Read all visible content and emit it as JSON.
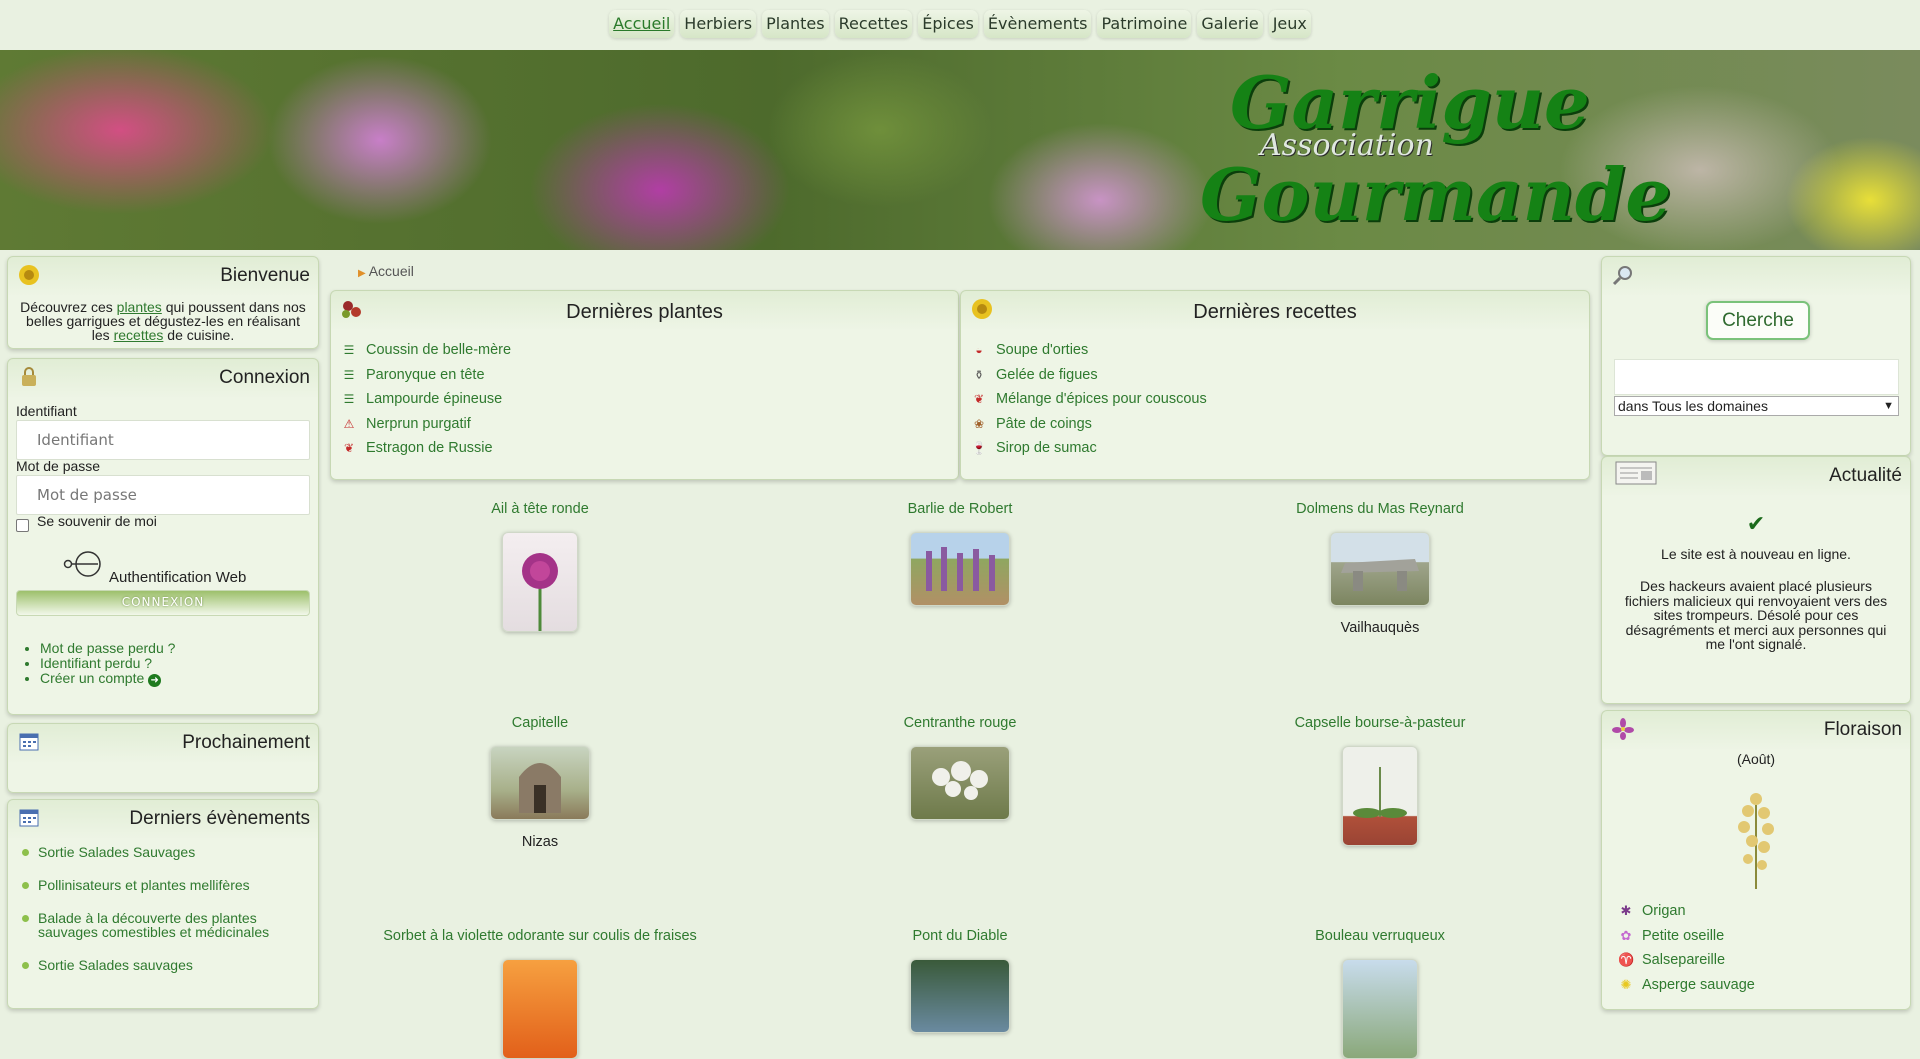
{
  "nav": [
    {
      "label": "Accueil",
      "active": true
    },
    {
      "label": "Herbiers"
    },
    {
      "label": "Plantes"
    },
    {
      "label": "Recettes"
    },
    {
      "label": "Épices"
    },
    {
      "label": "Évènements"
    },
    {
      "label": "Patrimoine"
    },
    {
      "label": "Galerie"
    },
    {
      "label": "Jeux"
    }
  ],
  "banner": {
    "line1": "Garrigue",
    "line2": "Association",
    "line3": "Gourmande"
  },
  "welcome": {
    "title": "Bienvenue",
    "t1": "Découvrez ces ",
    "link_plants": "plantes",
    "t2": " qui poussent dans nos belles garrigues et dégustez-les en réalisant les ",
    "link_recipes": "recettes",
    "t3": " de cuisine."
  },
  "login": {
    "title": "Connexion",
    "id_label": "Identifiant",
    "id_placeholder": "Identifiant",
    "pw_label": "Mot de passe",
    "pw_placeholder": "Mot de passe",
    "remember": "Se souvenir de moi",
    "web_auth": "Authentification Web",
    "button": "CONNEXION",
    "links": [
      "Mot de passe perdu ?",
      "Identifiant perdu ?",
      "Créer un compte"
    ]
  },
  "upcoming": {
    "title": "Prochainement"
  },
  "events": {
    "title": "Derniers évènements",
    "items": [
      "Sortie Salades Sauvages",
      "Pollinisateurs et plantes mellifères",
      "Balade à la découverte des plantes sauvages comestibles et médicinales",
      "Sortie Salades sauvages"
    ]
  },
  "breadcrumb": "Accueil",
  "latest_plants": {
    "title": "Dernières plantes",
    "items": [
      {
        "label": "Coussin de belle-mère",
        "icon": "list-icon"
      },
      {
        "label": "Paronyque en tête",
        "icon": "list-icon"
      },
      {
        "label": "Lampourde épineuse",
        "icon": "list-icon"
      },
      {
        "label": "Nerprun purgatif",
        "icon": "warning-icon"
      },
      {
        "label": "Estragon de Russie",
        "icon": "pepper-icon"
      }
    ]
  },
  "latest_recipes": {
    "title": "Dernières recettes",
    "items": [
      {
        "label": "Soupe d'orties",
        "icon": "soup-icon"
      },
      {
        "label": "Gelée de figues",
        "icon": "jar-icon"
      },
      {
        "label": "Mélange d'épices pour couscous",
        "icon": "pepper-icon"
      },
      {
        "label": "Pâte de coings",
        "icon": "dessert-icon"
      },
      {
        "label": "Sirop de sumac",
        "icon": "glass-icon"
      }
    ]
  },
  "grid": [
    {
      "title": "Ail à tête ronde",
      "sub": ""
    },
    {
      "title": "Barlie de Robert",
      "sub": ""
    },
    {
      "title": "Dolmens du Mas Reynard",
      "sub": "Vailhauquès"
    },
    {
      "title": "Capitelle",
      "sub": "Nizas"
    },
    {
      "title": "Centranthe rouge",
      "sub": ""
    },
    {
      "title": "Capselle bourse-à-pasteur",
      "sub": ""
    },
    {
      "title": "Sorbet à la violette odorante sur coulis de fraises",
      "sub": ""
    },
    {
      "title": "Pont du Diable",
      "sub": ""
    },
    {
      "title": "Bouleau verruqueux",
      "sub": ""
    }
  ],
  "search": {
    "button": "Cherche",
    "domain": "dans Tous les domaines"
  },
  "news": {
    "title": "Actualité",
    "p1": "Le site est à nouveau en ligne.",
    "p2": "Des hackeurs avaient placé plusieurs fichiers malicieux qui renvoyaient vers des sites trompeurs. Désolé pour ces désagréments et merci aux personnes qui me l'ont signalé."
  },
  "flowering": {
    "title": "Floraison",
    "month": "(Août)",
    "items": [
      "Origan",
      "Petite oseille",
      "Salsepareille",
      "Asperge sauvage"
    ]
  }
}
